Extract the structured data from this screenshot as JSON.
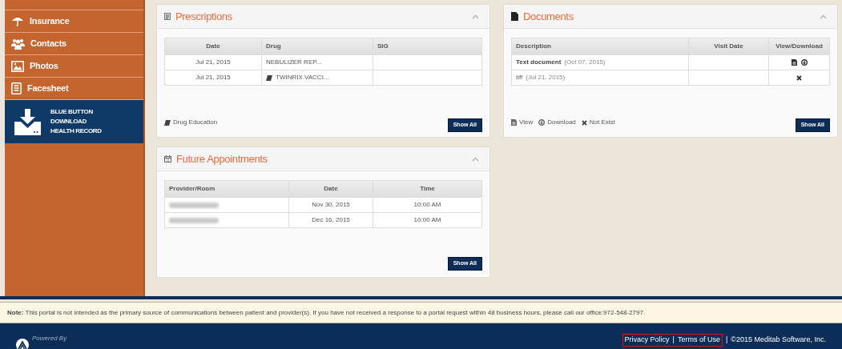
{
  "sidebar": {
    "items": [
      {
        "label": "Insurance"
      },
      {
        "label": "Contacts"
      },
      {
        "label": "Photos"
      },
      {
        "label": "Facesheet"
      }
    ],
    "blue_button": {
      "lines": [
        "BLUE BUTTON",
        "DOWNLOAD",
        "HEALTH RECORD"
      ]
    }
  },
  "prescriptions": {
    "title": "Prescriptions",
    "columns": [
      "Date",
      "Drug",
      "SIG"
    ],
    "rows": [
      {
        "date": "Jul 21, 2015",
        "drug": "NEBULIZER REP...",
        "education": false,
        "sig": ""
      },
      {
        "date": "Jul 21, 2015",
        "drug": "TWINRIX VACCI...",
        "education": true,
        "sig": ""
      }
    ],
    "link": "Drug Education",
    "button": "Show All"
  },
  "documents": {
    "title": "Documents",
    "columns": [
      "Description",
      "Visit Date",
      "View/Download"
    ],
    "rows": [
      {
        "name": "Text document",
        "date": "(Oct 07, 2015)",
        "exists": true
      },
      {
        "name": "tiff",
        "date": "(Jul 21, 2015)",
        "exists": false
      }
    ],
    "legend": [
      "View",
      "Download",
      "Not Exist"
    ],
    "button": "Show All"
  },
  "appointments": {
    "title": "Future Appointments",
    "columns": [
      "Provider/Room",
      "Date",
      "Time"
    ],
    "rows": [
      {
        "provider_redacted": true,
        "date": "Nov 30, 2015",
        "time": "10:00 AM"
      },
      {
        "provider_redacted": true,
        "date": "Dec 16, 2015",
        "time": "10:00 AM"
      }
    ],
    "button": "Show All"
  },
  "note": "**Note:** This portal is not intended as the primary source of communications between patient and provider(s). If you have not received a response to a portal request within 48 business hours, please call our office:972-548-2797.",
  "footer": {
    "powered_by": "Powered By",
    "links": [
      "Privacy Policy",
      "Terms of Use"
    ],
    "separators": [
      "|",
      "|"
    ],
    "copyright": "©2015 Meditab Software, Inc."
  }
}
